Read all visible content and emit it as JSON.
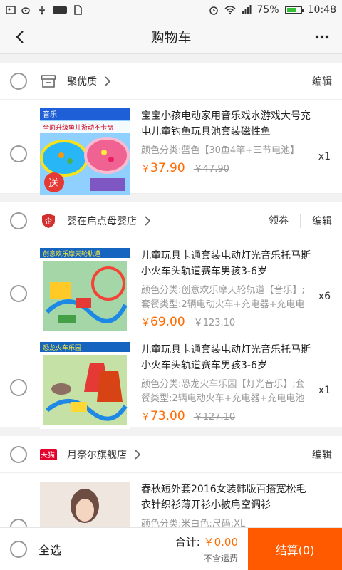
{
  "status_bar": {
    "battery": "75%",
    "time": "10:48",
    "battery_level": 0.75
  },
  "nav": {
    "title": "购物车"
  },
  "shops": [
    {
      "name": "聚优质",
      "icon": "store-icon",
      "actions": {
        "edit": "编辑"
      },
      "items": [
        {
          "title": "宝宝小孩电动家用音乐戏水游戏大号充电儿童钓鱼玩具池套装磁性鱼",
          "spec": "颜色分类:蓝色【30鱼4竿+三节电池】",
          "price_symbol": "￥",
          "price": "37.90",
          "orig_price": "￥47.90",
          "qty": "x1",
          "thumb_text": [
            "音乐",
            "全面升级鱼儿游动不卡盘",
            "送"
          ]
        }
      ]
    },
    {
      "name": "婴在启点母婴店",
      "icon": "shop-badge-icon",
      "actions": {
        "coupon": "领券",
        "edit": "编辑"
      },
      "items": [
        {
          "title": "儿童玩具卡通套装电动灯光音乐托马斯小火车头轨道赛车男孩3-6岁",
          "spec": "颜色分类:创意欢乐摩天轮轨道【音乐】;套餐类型:2辆电动火车+充电器+充电电池",
          "price_symbol": "￥",
          "price": "69.00",
          "orig_price": "￥123.10",
          "qty": "x6",
          "thumb_text": [
            "创意欢乐摩天轮轨道"
          ]
        },
        {
          "title": "儿童玩具卡通套装电动灯光音乐托马斯小火车头轨道赛车男孩3-6岁",
          "spec": "颜色分类:恐龙火车乐园【灯光音乐】;套餐类型:2辆电动火车+充电器+充电电池",
          "price_symbol": "￥",
          "price": "73.00",
          "orig_price": "￥127.10",
          "qty": "x1",
          "thumb_text": [
            "恐龙火车乐园"
          ]
        }
      ]
    },
    {
      "name": "月奈尔旗舰店",
      "icon": "tmall-icon",
      "badge_text": "天猫",
      "actions": {
        "edit": "编辑"
      },
      "items": [
        {
          "title": "春秋短外套2016女装韩版百搭宽松毛衣针织衫薄开衫小披肩空调衫",
          "spec": "颜色分类:米白色;尺码:XL",
          "price_symbol": "",
          "price": "",
          "orig_price": "",
          "qty": ""
        }
      ]
    }
  ],
  "bottom": {
    "select_all": "全选",
    "total_label": "合计:",
    "total_amount": "￥0.00",
    "shipping": "不含运费",
    "checkout": "结算(0)"
  },
  "colors": {
    "accent": "#ff5a00",
    "price": "#ff6a00",
    "battery": "#35c135"
  }
}
